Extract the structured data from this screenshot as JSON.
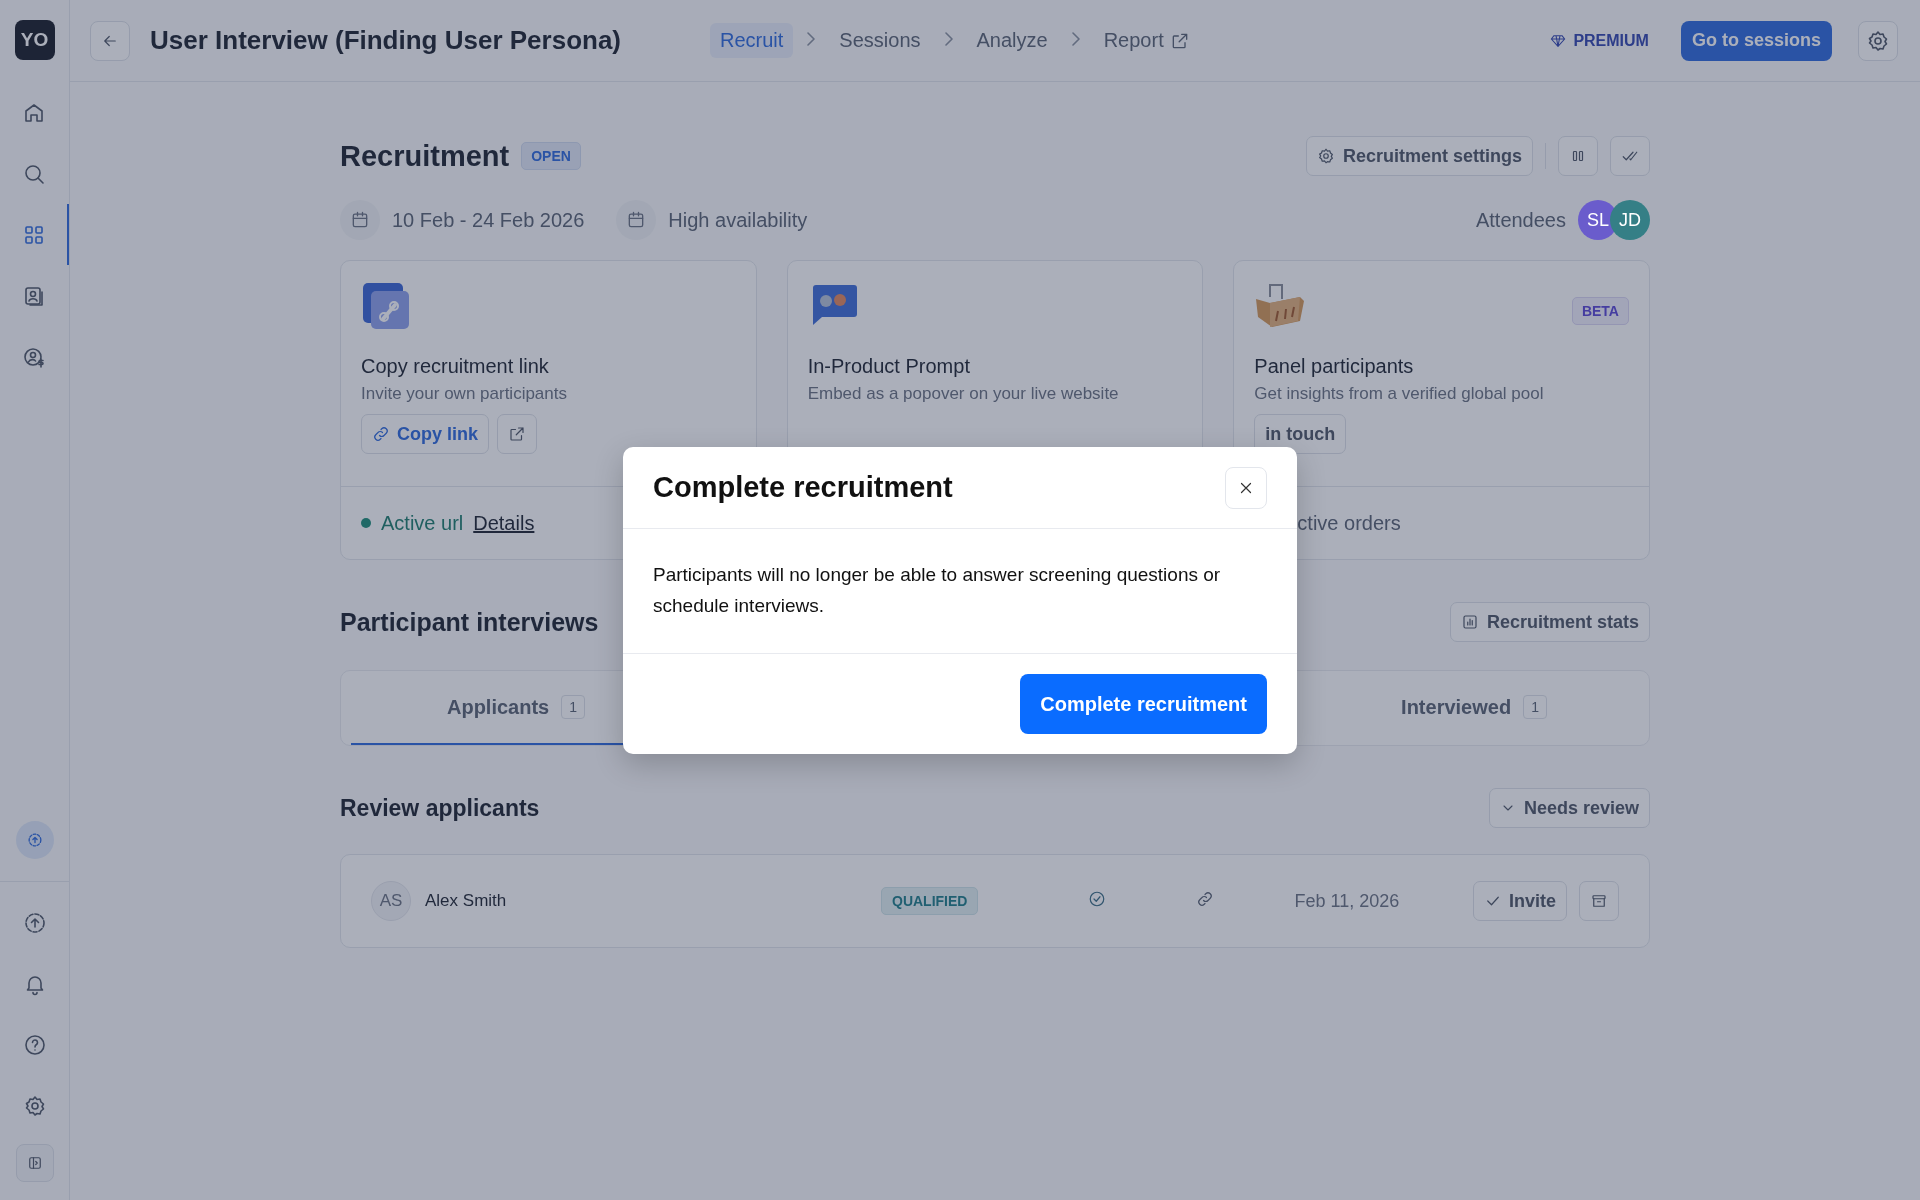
{
  "sidebar": {
    "logo": "YO",
    "items": [
      {
        "kind": "home",
        "selected": false
      },
      {
        "kind": "search",
        "selected": false
      },
      {
        "kind": "grid",
        "selected": true
      },
      {
        "kind": "contacts",
        "selected": false
      },
      {
        "kind": "billing",
        "selected": false
      }
    ],
    "bottom_items": [
      {
        "kind": "sync"
      },
      {
        "kind": "upload"
      },
      {
        "kind": "bell"
      },
      {
        "kind": "help"
      },
      {
        "kind": "settings"
      },
      {
        "kind": "panel"
      }
    ]
  },
  "header": {
    "title": "User Interview (Finding User Persona)",
    "steps": [
      {
        "label": "Recruit",
        "selected": true,
        "external": false
      },
      {
        "label": "Sessions",
        "selected": false,
        "external": false
      },
      {
        "label": "Analyze",
        "selected": false,
        "external": false
      },
      {
        "label": "Report",
        "selected": false,
        "external": true
      }
    ],
    "premium": "PREMIUM",
    "primary_button": "Go to sessions"
  },
  "recruitment": {
    "title": "Recruitment",
    "status": "OPEN",
    "settings_button": "Recruitment settings",
    "date_range": "10 Feb - 24 Feb 2026",
    "availability": "High availability",
    "attendees_label": "Attendees",
    "attendees": [
      {
        "initials": "SL",
        "color": "#6a5ccc"
      },
      {
        "initials": "JD",
        "color": "#357f86"
      }
    ]
  },
  "cards": [
    {
      "kind": "link",
      "title": "Copy recruitment link",
      "subtitle": "Invite your own participants",
      "action": "Copy link",
      "footer_status": "Active url",
      "footer_link": "Details"
    },
    {
      "kind": "prompt",
      "title": "In-Product Prompt",
      "subtitle": "Embed as a popover on your live website"
    },
    {
      "kind": "panel",
      "badge": "BETA",
      "title": "Panel participants",
      "subtitle": "Get insights from a verified global pool",
      "action": "in touch",
      "footer_text": "ctive orders"
    }
  ],
  "interviews": {
    "title": "Participant interviews",
    "stats_button": "Recruitment stats",
    "tabs": [
      {
        "label": "Applicants",
        "count": "1",
        "selected": true
      },
      {
        "label": "Interviewed",
        "count": "1",
        "selected": false
      }
    ],
    "review_title": "Review applicants",
    "filter": "Needs review",
    "applicants": [
      {
        "initials": "AS",
        "name": "Alex Smith",
        "status": "QUALIFIED",
        "date": "Feb 11, 2026",
        "action": "Invite"
      }
    ]
  },
  "modal": {
    "title": "Complete recruitment",
    "body": "Participants will no longer be able to answer screening questions or schedule interviews.",
    "confirm": "Complete recruitment"
  }
}
